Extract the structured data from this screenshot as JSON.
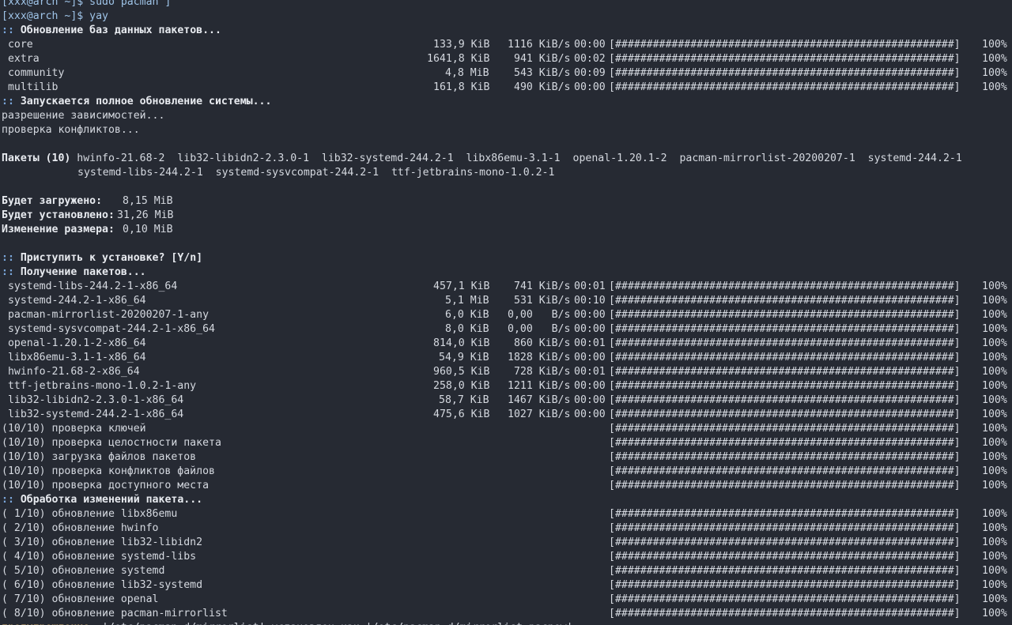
{
  "colors": {
    "background": "#262a33",
    "foreground": "#d5d9e0",
    "accent_blue": "#7aa6da",
    "warning_yellow": "#e5c07b"
  },
  "cropped_top_line": "[xxx@arch ~]$ sudo pacman ]",
  "prompt": {
    "user_host": "[xxx@arch ~]$",
    "command": "yay"
  },
  "section_sync": ":: Обновление баз данных пакетов...",
  "db_rows": [
    {
      "name": "core",
      "size": "133,9 KiB",
      "speed": "1116 KiB/s",
      "time": "00:00",
      "bar": "[######################################################]",
      "pct": "100%"
    },
    {
      "name": "extra",
      "size": "1641,8 KiB",
      "speed": "941 KiB/s",
      "time": "00:02",
      "bar": "[######################################################]",
      "pct": "100%"
    },
    {
      "name": "community",
      "size": "4,8 MiB",
      "speed": "543 KiB/s",
      "time": "00:09",
      "bar": "[######################################################]",
      "pct": "100%"
    },
    {
      "name": "multilib",
      "size": "161,8 KiB",
      "speed": "490 KiB/s",
      "time": "00:00",
      "bar": "[######################################################]",
      "pct": "100%"
    }
  ],
  "section_upgrade": ":: Запускается полное обновление системы...",
  "resolve_deps": "разрешение зависимостей...",
  "check_conflicts": "проверка конфликтов...",
  "packages_label": "Пакеты (10)",
  "packages_line1": "hwinfo-21.68-2  lib32-libidn2-2.3.0-1  lib32-systemd-244.2-1  libx86emu-3.1-1  openal-1.20.1-2  pacman-mirrorlist-20200207-1  systemd-244.2-1",
  "packages_line2": "systemd-libs-244.2-1  systemd-sysvcompat-244.2-1  ttf-jetbrains-mono-1.0.2-1",
  "summary": [
    {
      "label": "Будет загружено:",
      "value": "8,15 MiB"
    },
    {
      "label": "Будет установлено:",
      "value": "31,26 MiB"
    },
    {
      "label": "Изменение размера:",
      "value": "0,10 MiB"
    }
  ],
  "proceed_prompt": ":: Приступить к установке? [Y/n]",
  "section_fetch": ":: Получение пакетов...",
  "pkg_rows": [
    {
      "name": "systemd-libs-244.2-1-x86_64",
      "size": "457,1 KiB",
      "speed": "741 KiB/s",
      "time": "00:01",
      "bar": "[######################################################]",
      "pct": "100%"
    },
    {
      "name": "systemd-244.2-1-x86_64",
      "size": "5,1 MiB",
      "speed": "531 KiB/s",
      "time": "00:10",
      "bar": "[######################################################]",
      "pct": "100%"
    },
    {
      "name": "pacman-mirrorlist-20200207-1-any",
      "size": "6,0 KiB",
      "speed": "0,00   B/s",
      "time": "00:00",
      "bar": "[######################################################]",
      "pct": "100%"
    },
    {
      "name": "systemd-sysvcompat-244.2-1-x86_64",
      "size": "8,0 KiB",
      "speed": "0,00   B/s",
      "time": "00:00",
      "bar": "[######################################################]",
      "pct": "100%"
    },
    {
      "name": "openal-1.20.1-2-x86_64",
      "size": "814,0 KiB",
      "speed": "860 KiB/s",
      "time": "00:01",
      "bar": "[######################################################]",
      "pct": "100%"
    },
    {
      "name": "libx86emu-3.1-1-x86_64",
      "size": "54,9 KiB",
      "speed": "1828 KiB/s",
      "time": "00:00",
      "bar": "[######################################################]",
      "pct": "100%"
    },
    {
      "name": "hwinfo-21.68-2-x86_64",
      "size": "960,5 KiB",
      "speed": "728 KiB/s",
      "time": "00:01",
      "bar": "[######################################################]",
      "pct": "100%"
    },
    {
      "name": "ttf-jetbrains-mono-1.0.2-1-any",
      "size": "258,0 KiB",
      "speed": "1211 KiB/s",
      "time": "00:00",
      "bar": "[######################################################]",
      "pct": "100%"
    },
    {
      "name": "lib32-libidn2-2.3.0-1-x86_64",
      "size": "58,7 KiB",
      "speed": "1467 KiB/s",
      "time": "00:00",
      "bar": "[######################################################]",
      "pct": "100%"
    },
    {
      "name": "lib32-systemd-244.2-1-x86_64",
      "size": "475,6 KiB",
      "speed": "1027 KiB/s",
      "time": "00:00",
      "bar": "[######################################################]",
      "pct": "100%"
    }
  ],
  "check_rows": [
    {
      "text": "(10/10) проверка ключей",
      "bar": "[######################################################]",
      "pct": "100%"
    },
    {
      "text": "(10/10) проверка целостности пакета",
      "bar": "[######################################################]",
      "pct": "100%"
    },
    {
      "text": "(10/10) загрузка файлов пакетов",
      "bar": "[######################################################]",
      "pct": "100%"
    },
    {
      "text": "(10/10) проверка конфликтов файлов",
      "bar": "[######################################################]",
      "pct": "100%"
    },
    {
      "text": "(10/10) проверка доступного места",
      "bar": "[######################################################]",
      "pct": "100%"
    }
  ],
  "section_process": ":: Обработка изменений пакета...",
  "upgrade_rows": [
    {
      "text": "( 1/10) обновление libx86emu",
      "bar": "[######################################################]",
      "pct": "100%"
    },
    {
      "text": "( 2/10) обновление hwinfo",
      "bar": "[######################################################]",
      "pct": "100%"
    },
    {
      "text": "( 3/10) обновление lib32-libidn2",
      "bar": "[######################################################]",
      "pct": "100%"
    },
    {
      "text": "( 4/10) обновление systemd-libs",
      "bar": "[######################################################]",
      "pct": "100%"
    },
    {
      "text": "( 5/10) обновление systemd",
      "bar": "[######################################################]",
      "pct": "100%"
    },
    {
      "text": "( 6/10) обновление lib32-systemd",
      "bar": "[######################################################]",
      "pct": "100%"
    },
    {
      "text": "( 7/10) обновление openal",
      "bar": "[######################################################]",
      "pct": "100%"
    },
    {
      "text": "( 8/10) обновление pacman-mirrorlist",
      "bar": "[######################################################]",
      "pct": "100%"
    }
  ],
  "warning": {
    "label": "предупреждение:",
    "text": "'/etc/pacman.d/mirrorlist' установлен как '/etc/pacman.d/mirrorlist.pacnew'"
  }
}
